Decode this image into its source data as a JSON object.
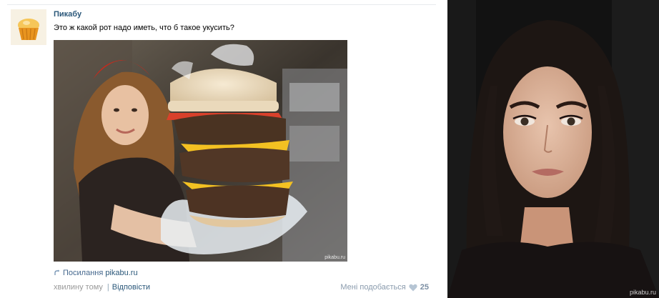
{
  "post": {
    "author": "Пикабу",
    "text": "Это ж какой рот надо иметь, что б такое укусить?",
    "photo_watermark": "pikabu.ru",
    "link_label": "Посилання",
    "link_url": "pikabu.ru",
    "time": "хвилину тому",
    "separator": "|",
    "reply_label": "Відповісти",
    "like_label": "Мені подобається",
    "like_count": "25"
  },
  "portrait": {
    "watermark": "pikabu.ru"
  },
  "colors": {
    "link": "#2b587a",
    "muted": "#999999",
    "like": "#8a9bad"
  },
  "icons": [
    "cupcake-avatar-icon",
    "link-arrow-icon",
    "heart-icon"
  ]
}
